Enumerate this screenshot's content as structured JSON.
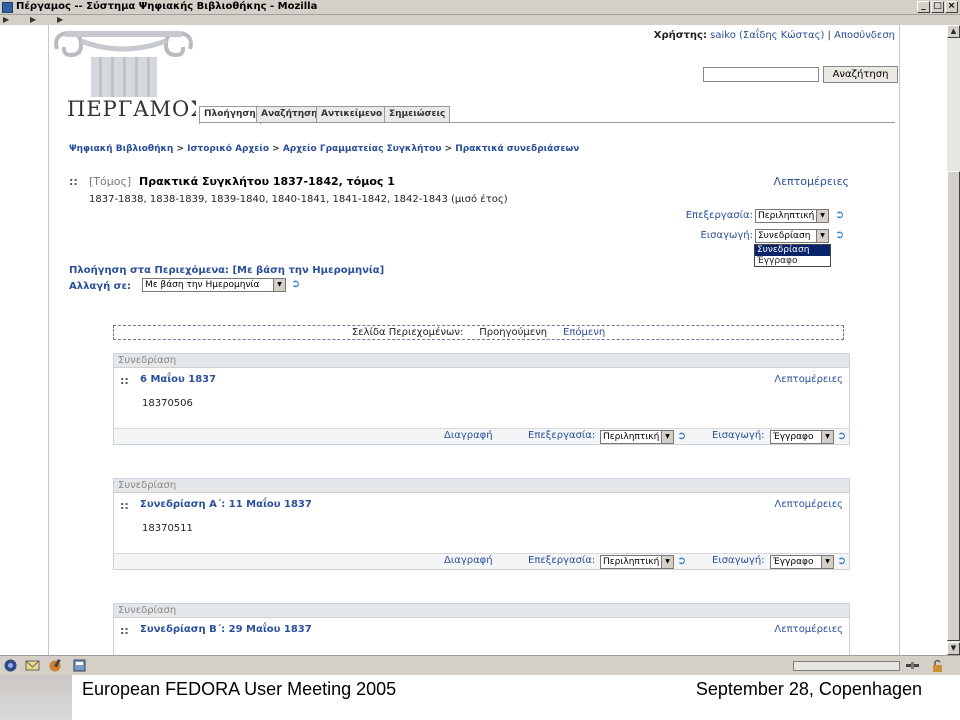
{
  "window": {
    "title": "Πέργαμος -- Σύστημα Ψηφιακής Βιβλιοθήκης - Mozilla",
    "min": "_",
    "max": "□",
    "close": "×"
  },
  "header": {
    "logo_text": "ΠΕΡΓΑΜΟΣ",
    "user_label": "Χρήστης:",
    "user_name": "saiko (Σαΐδης Κώστας)",
    "separator": "|",
    "logout": "Αποσύνδεση",
    "search_value": "",
    "search_button": "Αναζήτηση"
  },
  "tabs": [
    {
      "label": "Πλοήγηση",
      "active": true
    },
    {
      "label": "Αναζήτηση",
      "active": false
    },
    {
      "label": "Αντικείμενο",
      "active": false
    },
    {
      "label": "Σημειώσεις",
      "active": false
    }
  ],
  "breadcrumb": {
    "c1": "Ψηφιακή Βιβλιοθήκη",
    "c2": "Ιστορικό Αρχείο",
    "c3": "Αρχείο Γραμματείας Συγκλήτου",
    "c4": "Πρακτικά συνεδριάσεων",
    "sep": ">"
  },
  "volume": {
    "colons": "::",
    "kind": "[Τόμος]",
    "title": "Πρακτικά Συγκλήτου 1837-1842, τόμος 1",
    "details": "Λεπτομέρειες",
    "years": "1837-1838, 1838-1839, 1839-1840, 1840-1841, 1841-1842, 1842-1843 (μισό έτος)",
    "edit_label": "Επεξεργασία:",
    "edit_value": "Περιληπτική",
    "insert_label": "Εισαγωγή:",
    "insert_value": "Συνεδρίαση",
    "insert_options": [
      "Συνεδρίαση",
      "Έγγραφο"
    ]
  },
  "navigation": {
    "title": "Πλοήγηση στα Περιεχόμενα: [Με βάση την Ημερομηνία]",
    "change_label": "Αλλαγή σε:",
    "change_value": "Με βάση την Ημερομηνία"
  },
  "pager": {
    "label": "Σελίδα Περιεχομένων:",
    "prev": "Προηγούμενη",
    "next": "Επόμενη"
  },
  "records": [
    {
      "type": "Συνεδρίαση",
      "title": "6 Μαΐου 1837",
      "details": "Λεπτομέρειες",
      "id": "18370506",
      "delete": "Διαγραφή",
      "edit_label": "Επεξεργασία:",
      "edit_value": "Περιληπτική",
      "insert_label": "Εισαγωγή:",
      "insert_value": "Έγγραφο"
    },
    {
      "type": "Συνεδρίαση",
      "title": "Συνεδρίαση Α΄: 11 Μαΐου 1837",
      "details": "Λεπτομέρειες",
      "id": "18370511",
      "delete": "Διαγραφή",
      "edit_label": "Επεξεργασία:",
      "edit_value": "Περιληπτική",
      "insert_label": "Εισαγωγή:",
      "insert_value": "Έγγραφο"
    },
    {
      "type": "Συνεδρίαση",
      "title": "Συνεδρίαση Β΄: 29 Μαΐου 1837",
      "details": "Λεπτομέρειες"
    }
  ],
  "footer": {
    "left": "European FEDORA User Meeting 2005",
    "right": "September 28, Copenhagen"
  },
  "icons": {
    "go": "arrow-right-icon",
    "dropdown": "chevron-down-icon"
  }
}
